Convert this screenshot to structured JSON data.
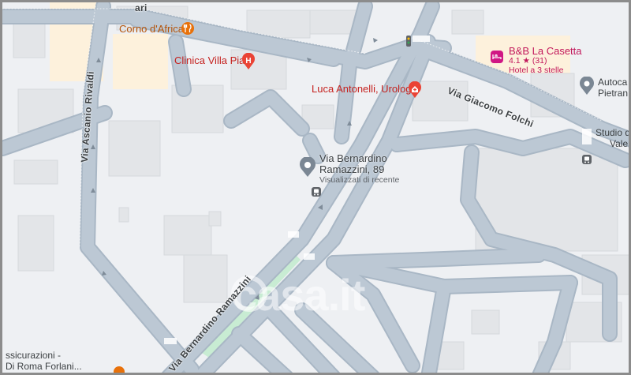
{
  "map": {
    "watermark": "casa.it"
  },
  "pois": {
    "corno_dafrica": "Corno d'Africa",
    "clinica_villa_pia": "Clinica Villa Pia",
    "luca_antonelli": "Luca Antonelli, Urologo",
    "bb_la_casetta": "B&B La Casetta",
    "bb_rating": "4.1 ★ (31)",
    "bb_type": "Hotel a 3 stelle",
    "autoca_line1": "Autoca",
    "autoca_line2": "Pietran",
    "studio_line1": "Studio d",
    "studio_line2": "Vale",
    "assicurazioni_line1": "ssicurazioni -",
    "assicurazioni_line2": "Di Roma Forlani...",
    "top_partial": "ari"
  },
  "place": {
    "line1": "Via Bernardino",
    "line2": "Ramazzini, 89",
    "sub": "Visualizzati di recente"
  },
  "streets": {
    "asciano": "Via Ascanio Rivaldi",
    "folchi": "Via Giacomo Folchi",
    "ramazzini": "Via Bernardino Ramazzini"
  },
  "colors": {
    "road": "#b9c6d3",
    "road_edge": "#a6b4c2",
    "block": "#e3e5e8",
    "park": "#c8ecd3",
    "beige": "#fdf1dc",
    "poi_red": "#c5221f",
    "poi_orange": "#e8710a",
    "poi_pink": "#d01884"
  }
}
